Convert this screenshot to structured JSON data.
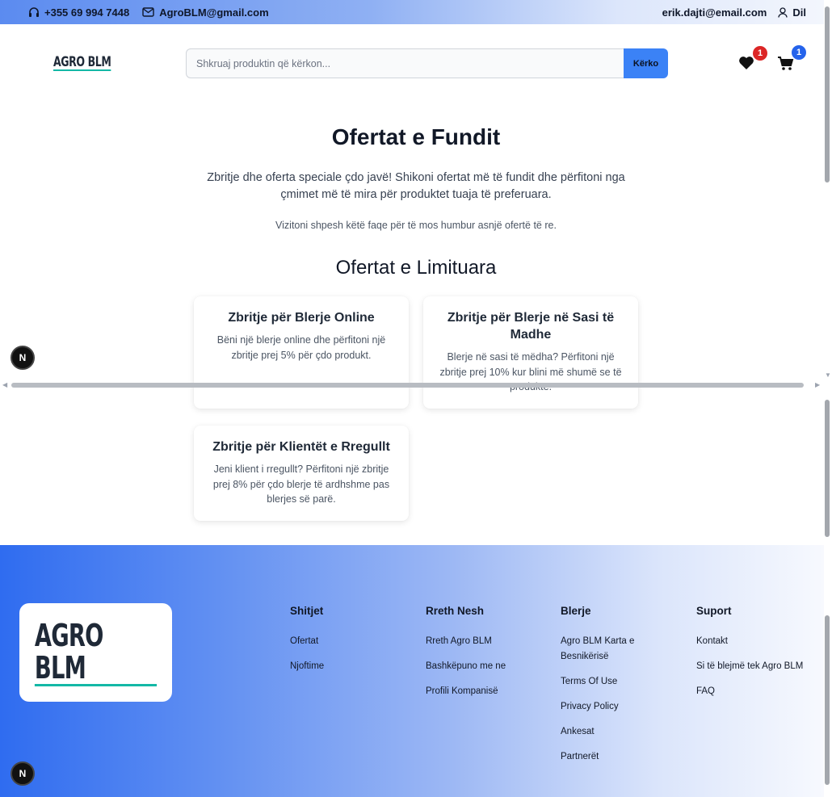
{
  "topbar": {
    "phone": "+355 69 994 7448",
    "email": "AgroBLM@gmail.com",
    "user_email": "erik.dajti@email.com",
    "logout": "Dil"
  },
  "header": {
    "logo": "AGRO BLM",
    "search_placeholder": "Shkruaj produktin që kërkon...",
    "search_button": "Kërko",
    "wishlist_count": "1",
    "cart_count": "1"
  },
  "main": {
    "title": "Ofertat e Fundit",
    "lead": "Zbritje dhe oferta speciale çdo javë! Shikoni ofertat më të fundit dhe përfitoni nga çmimet më të mira për produktet tuaja të preferuara.",
    "note": "Vizitoni shpesh këtë faqe për të mos humbur asnjë ofertë të re.",
    "section_title": "Ofertat e Limituara",
    "cards": [
      {
        "title": "Zbritje për Blerje Online",
        "text": "Bëni një blerje online dhe përfitoni një zbritje prej 5% për çdo produkt."
      },
      {
        "title": "Zbritje për Blerje në Sasi të Madhe",
        "text": "Blerje në sasi të mëdha? Përfitoni një zbritje prej 10% kur blini më shumë se të produkte."
      },
      {
        "title": "Zbritje për Klientët e Rregullt",
        "text": "Jeni klient i rregullt? Përfitoni një zbritje prej 8% për çdo blerje të ardhshme pas blerjes së parë."
      }
    ]
  },
  "dev_badge": "N",
  "footer": {
    "logo": "AGRO BLM",
    "columns": [
      {
        "heading": "Shitjet",
        "links": [
          "Ofertat",
          "Njoftime"
        ]
      },
      {
        "heading": "Rreth Nesh",
        "links": [
          "Rreth Agro BLM",
          "Bashkëpuno me ne",
          "Profili Kompanisë"
        ]
      },
      {
        "heading": "Blerje",
        "links": [
          "Agro BLM Karta e Besnikërisë",
          "Terms Of Use",
          "Privacy Policy",
          "Ankesat",
          "Partnerët"
        ]
      },
      {
        "heading": "Suport",
        "links": [
          "Kontakt",
          "Si të blejmë tek Agro BLM",
          "FAQ"
        ]
      }
    ]
  },
  "colors": {
    "accent": "#3b82f6",
    "wishlist_badge": "#dc2626",
    "cart_badge": "#2563eb",
    "logo_underline": "#14b8a6"
  }
}
